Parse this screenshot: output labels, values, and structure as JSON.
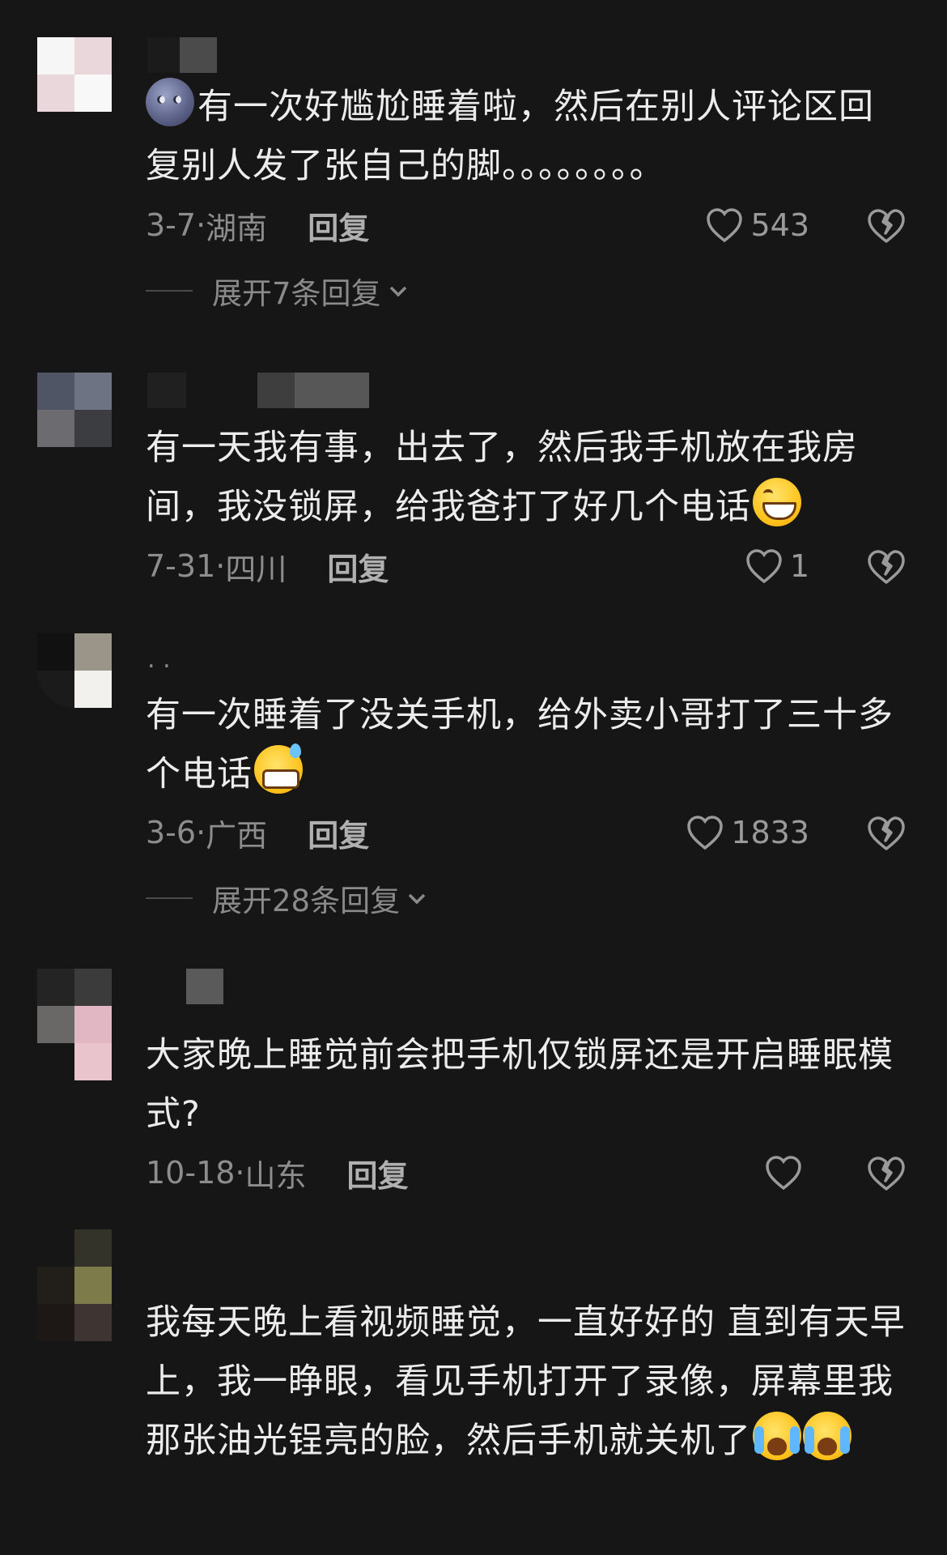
{
  "comments": [
    {
      "avatar": [
        "#f6f6f6",
        "#ead7db",
        "#ead7db",
        "#f8f8f8"
      ],
      "username_blocks": [
        "#1b1b1b",
        "#2a2a2a",
        "#4b4b4b"
      ],
      "text": "有一次好尴尬睡着啦，然后在别人评论区回复别人发了张自己的脚。。。。。。。。",
      "emoji_before": "moon-face-icon",
      "date": "3-7",
      "location": "湖南",
      "reply": "回复",
      "likes": "543",
      "expand": "展开7条回复"
    },
    {
      "avatar": [
        "#4f5564",
        "#6e7384",
        "#6c6c70",
        "#3c3d40"
      ],
      "username_blocks": [
        "#222222",
        "#3e3e3e",
        "#575757"
      ],
      "text": "有一天我有事，出去了，然后我手机放在我房间，我没锁屏，给我爸打了好几个电话",
      "emoji_after": "grinning-face-icon",
      "date": "7-31",
      "location": "四川",
      "reply": "回复",
      "likes": "1"
    },
    {
      "avatar": [
        "#111111",
        "#9a9489",
        "#1b1b1b",
        "#f3f1ee"
      ],
      "username_blocks": [],
      "username_dots": ". .",
      "text": "有一次睡着了没关手机，给外卖小哥打了三十多个电话",
      "emoji_after": "sweat-grin-face-icon",
      "date": "3-6",
      "location": "广西",
      "reply": "回复",
      "likes": "1833",
      "expand": "展开28条回复"
    },
    {
      "avatar": [
        "#252424",
        "#3b3b3b",
        "#6a6767",
        "#e0b7c3",
        "#161616",
        "#e9c4cc"
      ],
      "username_blocks": [
        "#5a5a5a"
      ],
      "text": "大家晚上睡觉前会把手机仅锁屏还是开启睡眠模式?",
      "date": "10-18",
      "location": "山东",
      "reply": "回复",
      "likes": ""
    },
    {
      "avatar": [
        "#161616",
        "#34332a",
        "#221f1a",
        "#7e7b4a",
        "#1d1716",
        "#3e3533"
      ],
      "username_blocks": [],
      "text": "我每天晚上看视频睡觉，一直好好的 直到有天早上，我一睁眼，看见手机打开了录像，屏幕里我那张油光锃亮的脸，然后手机就关机了",
      "emoji_after": "crying-face-icon",
      "emoji_after_2": "crying-face-icon"
    }
  ],
  "separator": "·"
}
